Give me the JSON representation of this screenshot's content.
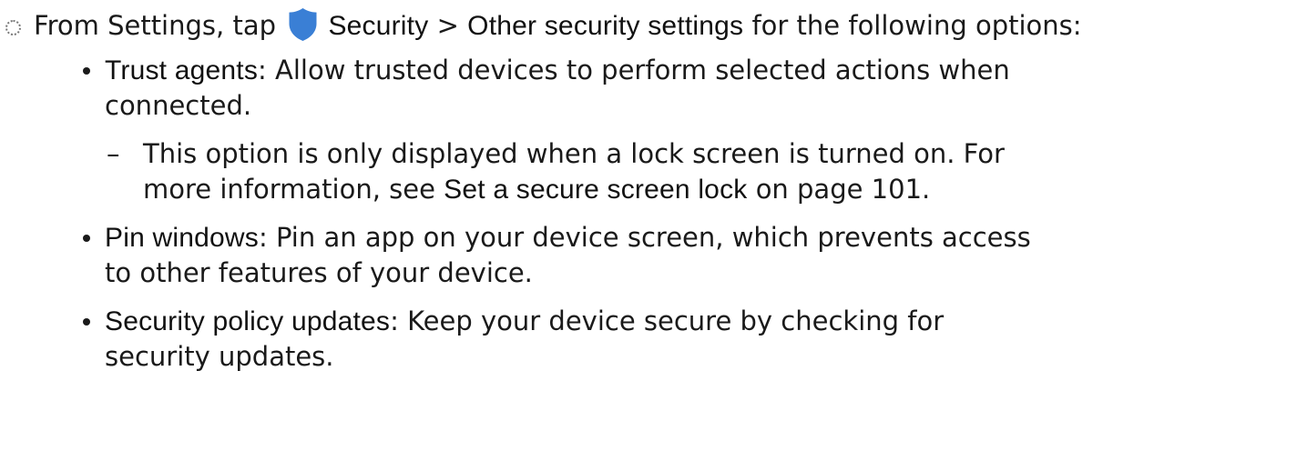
{
  "step": {
    "text_before": "From Settings, tap",
    "security_label": "Security",
    "separator": ">",
    "other_label": "Other security settings",
    "text_after": "for the following options:",
    "icon": "shield-icon",
    "icon_color": "#3a7fd5"
  },
  "items": [
    {
      "term": "Trust agents",
      "description": ": Allow trusted devices to perform selected actions when connected.",
      "note": {
        "dash": "–",
        "text_before": "This option is only displayed when a lock screen is turned on. For more information, see",
        "link": "Set a secure screen lock",
        "text_after": "on page 101."
      }
    },
    {
      "term": "Pin windows",
      "description": ": Pin an app on your device screen, which prevents access to other features of your device."
    },
    {
      "term": "Security policy updates",
      "description": ": Keep your device secure by checking for security updates."
    }
  ]
}
